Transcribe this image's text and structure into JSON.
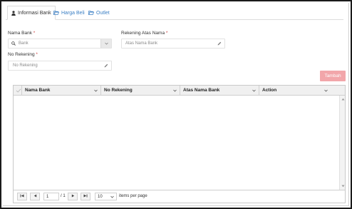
{
  "tabs": [
    {
      "label": "Informasi Bank",
      "icon": "user-icon",
      "active": true
    },
    {
      "label": "Harga Beli",
      "icon": "folder-open-icon",
      "active": false
    },
    {
      "label": "Outlet",
      "icon": "folder-open-icon",
      "active": false
    }
  ],
  "form": {
    "nama_bank": {
      "label": "Nama Bank",
      "required": "*",
      "placeholder": "Bank"
    },
    "rekening_atas_nama": {
      "label": "Rekening Atas Nama",
      "required": "*",
      "placeholder": "Atas Nama Bank"
    },
    "no_rekening": {
      "label": "No Rekening",
      "required": "*",
      "placeholder": "No Rekening"
    }
  },
  "add_button": {
    "label": "Tambah",
    "color": "#f2a6aa"
  },
  "grid": {
    "columns": [
      "Nama Bank",
      "No Rekening",
      "Atas Nama Bank",
      "Action"
    ],
    "rows": []
  },
  "pager": {
    "page": "1",
    "of_label": "/ 1",
    "page_size": "10",
    "items_per_page_label": "items per page"
  },
  "colors": {
    "link": "#3b7fc4",
    "header_bg": "#f0f0f0"
  }
}
